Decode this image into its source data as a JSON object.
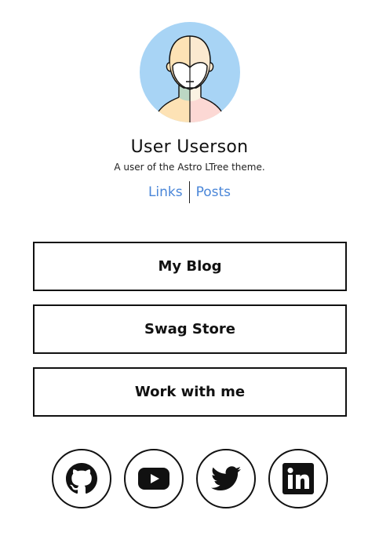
{
  "profile": {
    "name": "User Userson",
    "tagline": "A user of the Astro LTree theme."
  },
  "nav": {
    "links_label": "Links",
    "posts_label": "Posts"
  },
  "links": [
    {
      "label": "My Blog"
    },
    {
      "label": "Swag Store"
    },
    {
      "label": "Work with me"
    }
  ],
  "social": [
    {
      "icon": "github-icon"
    },
    {
      "icon": "youtube-icon"
    },
    {
      "icon": "twitter-icon"
    },
    {
      "icon": "linkedin-icon"
    }
  ],
  "colors": {
    "link": "#4a86d8",
    "avatar_bg": "#a8d4f5"
  }
}
